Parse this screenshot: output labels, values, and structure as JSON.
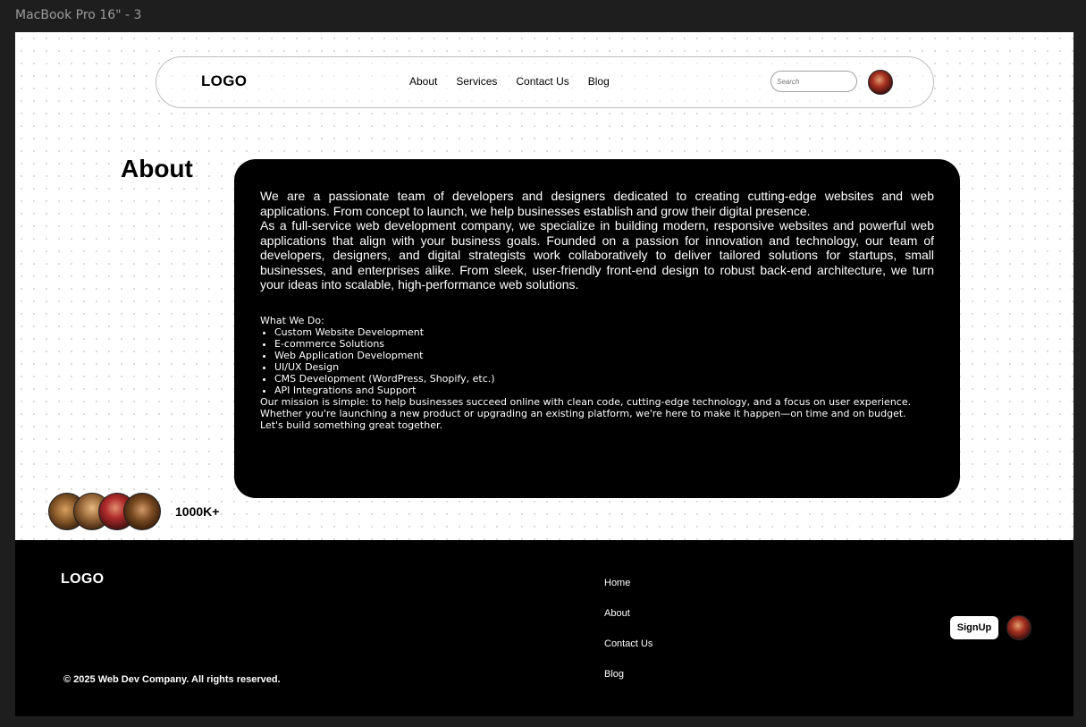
{
  "frame_label": "MacBook Pro 16\" - 3",
  "nav": {
    "logo": "LOGO",
    "links": [
      "About",
      "Services",
      "Contact Us",
      "Blog"
    ],
    "search_placeholder": "Search",
    "avatar_icon": "user-avatar-icon"
  },
  "about": {
    "heading": "About",
    "intro": [
      "We are a passionate team of developers and designers dedicated to creating cutting-edge websites and web applications. From concept to launch, we help businesses establish and grow their digital presence.",
      "As a full-service web development company, we specialize in building modern, responsive websites and powerful web applications that align with your business goals. Founded on a passion for innovation and technology, our team of developers, designers, and digital strategists work collaboratively to deliver tailored solutions for startups, small businesses, and enterprises alike. From sleek, user-friendly front-end design to robust back-end architecture, we turn your ideas into scalable, high-performance web solutions."
    ],
    "what_we_do_title": "What We Do:",
    "services": [
      "Custom Website Development",
      "E-commerce Solutions",
      "Web Application Development",
      "UI/UX Design",
      "CMS Development (WordPress, Shopify, etc.)",
      "API Integrations and Support"
    ],
    "mission": "Our mission is simple: to help businesses succeed online with clean code, cutting-edge technology, and a focus on user experience. Whether you're launching a new product or upgrading an existing platform, we're here to make it happen—on time and on budget.",
    "closing": "Let's build something great together."
  },
  "social_proof": {
    "count": "1000K+"
  },
  "footer": {
    "logo": "LOGO",
    "copyright": "© 2025 Web Dev Company. All rights reserved.",
    "links": [
      "Home",
      "About",
      "Contact Us",
      "Blog"
    ],
    "signup_label": "SignUp"
  }
}
